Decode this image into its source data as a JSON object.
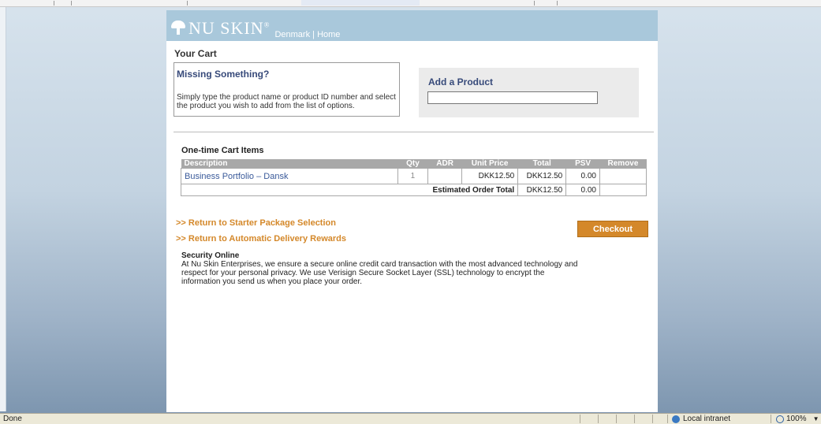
{
  "banner": {
    "brand": "NU SKIN",
    "trademark": "®",
    "country": "Denmark",
    "separator": "|",
    "home": "Home"
  },
  "cart": {
    "title": "Your Cart"
  },
  "missing": {
    "title": "Missing Something?",
    "text": "Simply type the product name or product ID number and select the product you wish to add from the list of options."
  },
  "add_product": {
    "title": "Add a Product",
    "value": ""
  },
  "items": {
    "title": "One-time Cart Items",
    "headers": [
      "Description",
      "Qty",
      "ADR",
      "Unit Price",
      "Total",
      "PSV",
      "Remove"
    ],
    "rows": [
      {
        "description": "Business Portfolio – Dansk",
        "qty": "1",
        "adr": "",
        "unit_price": "DKK12.50",
        "total": "DKK12.50",
        "psv": "0.00",
        "remove": ""
      }
    ],
    "estimated_label": "Estimated Order Total",
    "estimated_total": "DKK12.50",
    "estimated_psv": "0.00"
  },
  "links": {
    "starter": ">> Return to Starter Package Selection",
    "adr": ">> Return to Automatic Delivery Rewards"
  },
  "checkout_label": "Checkout",
  "security": {
    "title": "Security Online",
    "text": "At Nu Skin Enterprises, we ensure a secure online credit card transaction with the most advanced technology and respect for your personal privacy. We use Verisign Secure Socket Layer (SSL) technology to encrypt the information you send us when you place your order."
  },
  "statusbar": {
    "status": "Done",
    "zone": "Local intranet",
    "zoom": "100%"
  },
  "colors": {
    "banner": "#a9c8db",
    "accent": "#d4882a",
    "heading": "#374a7a",
    "table_header": "#a8a8a8"
  }
}
